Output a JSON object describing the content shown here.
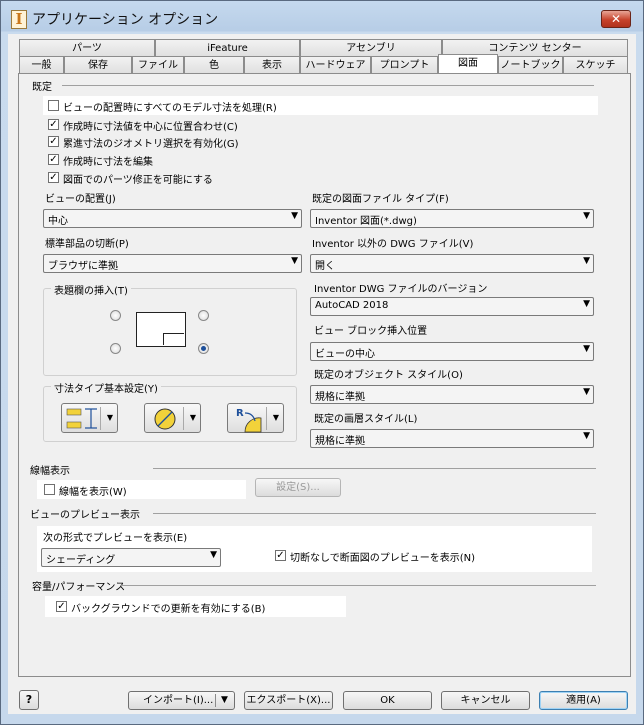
{
  "window": {
    "title": "アプリケーション オプション",
    "close_label": "✕"
  },
  "tabs_row1": [
    "パーツ",
    "iFeature",
    "アセンブリ",
    "コンテンツ センター"
  ],
  "tabs_row2": [
    "一般",
    "保存",
    "ファイル",
    "色",
    "表示",
    "ハードウェア",
    "プロンプト",
    "図面",
    "ノートブック",
    "スケッチ"
  ],
  "active_tab": "図面",
  "defaults": {
    "section_label": "既定",
    "checkboxes": [
      {
        "label": "ビューの配置時にすべてのモデル寸法を処理(R)",
        "checked": false
      },
      {
        "label": "作成時に寸法値を中心に位置合わせ(C)",
        "checked": true
      },
      {
        "label": "累進寸法のジオメトリ選択を有効化(G)",
        "checked": true
      },
      {
        "label": "作成時に寸法を編集",
        "checked": true
      },
      {
        "label": "図面でのパーツ修正を可能にする",
        "checked": true
      }
    ],
    "view_placement": {
      "label": "ビューの配置(J)",
      "value": "中心"
    },
    "standard_parts": {
      "label": "標準部品の切断(P)",
      "value": "ブラウザに準拠"
    },
    "title_block": {
      "label": "表題欄の挿入(T)"
    },
    "dim_type": {
      "label": "寸法タイプ基本設定(Y)"
    },
    "drawing_file_type": {
      "label": "既定の図面ファイル タイプ(F)",
      "value": "Inventor 図面(*.dwg)"
    },
    "non_inventor_dwg": {
      "label": "Inventor 以外の DWG ファイル(V)",
      "value": "開く"
    },
    "dwg_version": {
      "label": "Inventor DWG ファイルのバージョン",
      "value": "AutoCAD 2018"
    },
    "view_block_position": {
      "label": "ビュー ブロック挿入位置",
      "value": "ビューの中心"
    },
    "object_style": {
      "label": "既定のオブジェクト スタイル(O)",
      "value": "規格に準拠"
    },
    "layer_style": {
      "label": "既定の画層スタイル(L)",
      "value": "規格に準拠"
    }
  },
  "lineweight": {
    "section_label": "線幅表示",
    "show_label": "線幅を表示(W)",
    "checked": false,
    "settings_button": "設定(S)..."
  },
  "preview": {
    "section_label": "ビューのプレビュー表示",
    "format_label": "次の形式でプレビューを表示(E)",
    "format_value": "シェーディング",
    "section_preview_label": "切断なしで断面図のプレビューを表示(N)",
    "section_preview_checked": true
  },
  "performance": {
    "section_label": "容量/パフォーマンス",
    "background_label": "バックグラウンドでの更新を有効にする(B)",
    "background_checked": true
  },
  "footer": {
    "import_label": "インポート(I)...",
    "export_label": "エクスポート(X)...",
    "ok_label": "OK",
    "cancel_label": "キャンセル",
    "apply_label": "適用(A)"
  },
  "colors": {
    "accent_blue": "#1d4f9a",
    "title_bar": "#b7cde6",
    "close_red": "#c7432c",
    "dim_yellow": "#f2d23a"
  }
}
